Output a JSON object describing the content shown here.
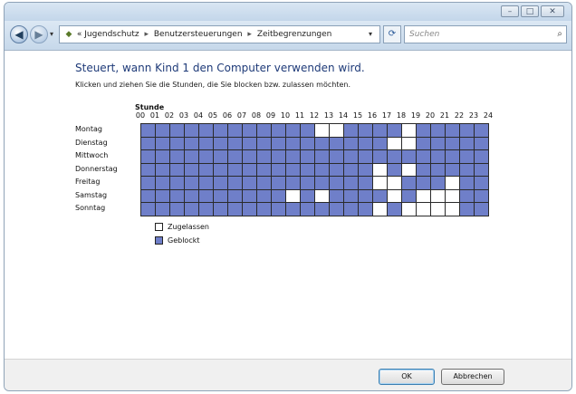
{
  "window": {
    "controls": {
      "minimize": "–",
      "maximize": "□",
      "close": "✕"
    }
  },
  "nav": {
    "back_glyph": "◀",
    "forward_glyph": "▶",
    "history_glyph": "▾",
    "address_prefix": "«",
    "breadcrumbs": [
      "Jugendschutz",
      "Benutzersteuerungen",
      "Zeitbegrenzungen"
    ],
    "breadcrumb_sep": "▸",
    "address_dropdown_glyph": "▾",
    "refresh_glyph": "⟳",
    "search_placeholder": "Suchen",
    "search_glyph": "⌕"
  },
  "content": {
    "title": "Steuert, wann Kind 1 den Computer verwenden wird.",
    "subtitle": "Klicken und ziehen Sie die Stunden, die Sie blocken bzw. zulassen möchten.",
    "hours_label": "Stunde",
    "hours": [
      "00",
      "01",
      "02",
      "03",
      "04",
      "05",
      "06",
      "07",
      "08",
      "09",
      "10",
      "11",
      "12",
      "13",
      "14",
      "15",
      "16",
      "17",
      "18",
      "19",
      "20",
      "21",
      "22",
      "23",
      "24"
    ],
    "days": [
      "Montag",
      "Dienstag",
      "Mittwoch",
      "Donnerstag",
      "Freitag",
      "Samstag",
      "Sonntag"
    ],
    "grid": [
      [
        1,
        1,
        1,
        1,
        1,
        1,
        1,
        1,
        1,
        1,
        1,
        1,
        0,
        0,
        1,
        1,
        1,
        1,
        0,
        1,
        1,
        1,
        1,
        1
      ],
      [
        1,
        1,
        1,
        1,
        1,
        1,
        1,
        1,
        1,
        1,
        1,
        1,
        1,
        1,
        1,
        1,
        1,
        0,
        0,
        1,
        1,
        1,
        1,
        1
      ],
      [
        1,
        1,
        1,
        1,
        1,
        1,
        1,
        1,
        1,
        1,
        1,
        1,
        1,
        1,
        1,
        1,
        1,
        1,
        1,
        1,
        1,
        1,
        1,
        1
      ],
      [
        1,
        1,
        1,
        1,
        1,
        1,
        1,
        1,
        1,
        1,
        1,
        1,
        1,
        1,
        1,
        1,
        0,
        1,
        0,
        1,
        1,
        1,
        1,
        1
      ],
      [
        1,
        1,
        1,
        1,
        1,
        1,
        1,
        1,
        1,
        1,
        1,
        1,
        1,
        1,
        1,
        1,
        0,
        0,
        1,
        1,
        1,
        0,
        1,
        1
      ],
      [
        1,
        1,
        1,
        1,
        1,
        1,
        1,
        1,
        1,
        1,
        0,
        1,
        0,
        1,
        1,
        1,
        1,
        0,
        1,
        0,
        0,
        0,
        1,
        1
      ],
      [
        1,
        1,
        1,
        1,
        1,
        1,
        1,
        1,
        1,
        1,
        1,
        1,
        1,
        1,
        1,
        1,
        0,
        1,
        0,
        0,
        0,
        0,
        1,
        1
      ]
    ],
    "legend": {
      "allowed": "Zugelassen",
      "blocked": "Geblockt"
    },
    "colors": {
      "blocked": "#6f7fc9",
      "allowed": "#ffffff",
      "title": "#1e3a78"
    }
  },
  "footer": {
    "ok_label": "OK",
    "cancel_label": "Abbrechen"
  }
}
